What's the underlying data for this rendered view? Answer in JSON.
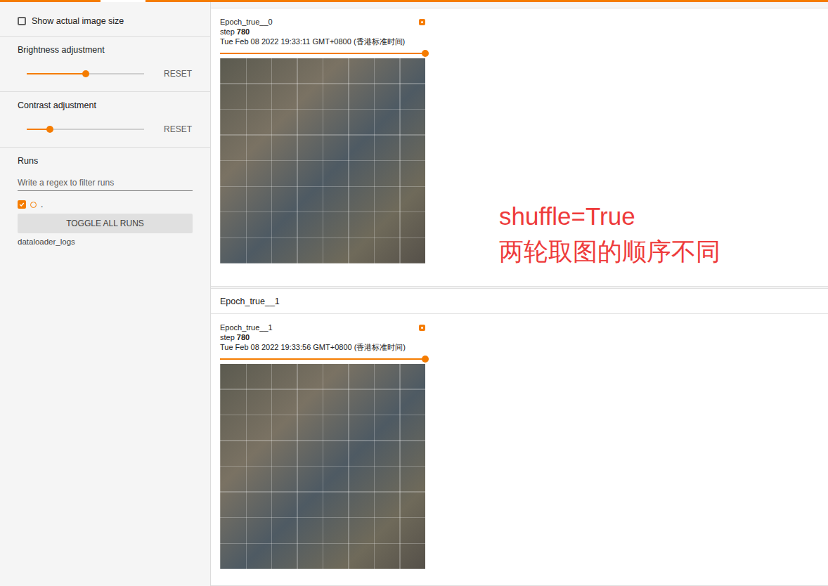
{
  "sidebar": {
    "show_actual_size": {
      "label": "Show actual image size",
      "checked": false
    },
    "brightness": {
      "label": "Brightness adjustment",
      "level": 0.5,
      "reset": "RESET"
    },
    "contrast": {
      "label": "Contrast adjustment",
      "level": 0.2,
      "reset": "RESET"
    },
    "runs": {
      "title": "Runs",
      "filter_placeholder": "Write a regex to filter runs",
      "items": [
        {
          "label": ".",
          "checked": true,
          "color": "#f57c00"
        }
      ],
      "toggle_button": "TOGGLE ALL RUNS",
      "logdir": "dataloader_logs"
    }
  },
  "sections": [
    {
      "header": "",
      "cards": [
        {
          "tag": "Epoch_true__0",
          "step_label": "step",
          "step": "780",
          "time": "Tue Feb 08 2022 19:33:11 GMT+0800 (香港标准时间)",
          "step_level": 1
        }
      ]
    },
    {
      "header": "Epoch_true__1",
      "cards": [
        {
          "tag": "Epoch_true__1",
          "step_label": "step",
          "step": "780",
          "time": "Tue Feb 08 2022 19:33:56 GMT+0800 (香港标准时间)",
          "step_level": 1
        }
      ]
    }
  ],
  "annotation": {
    "lines": [
      "shuffle=True",
      "两轮取图的顺序不同"
    ]
  }
}
